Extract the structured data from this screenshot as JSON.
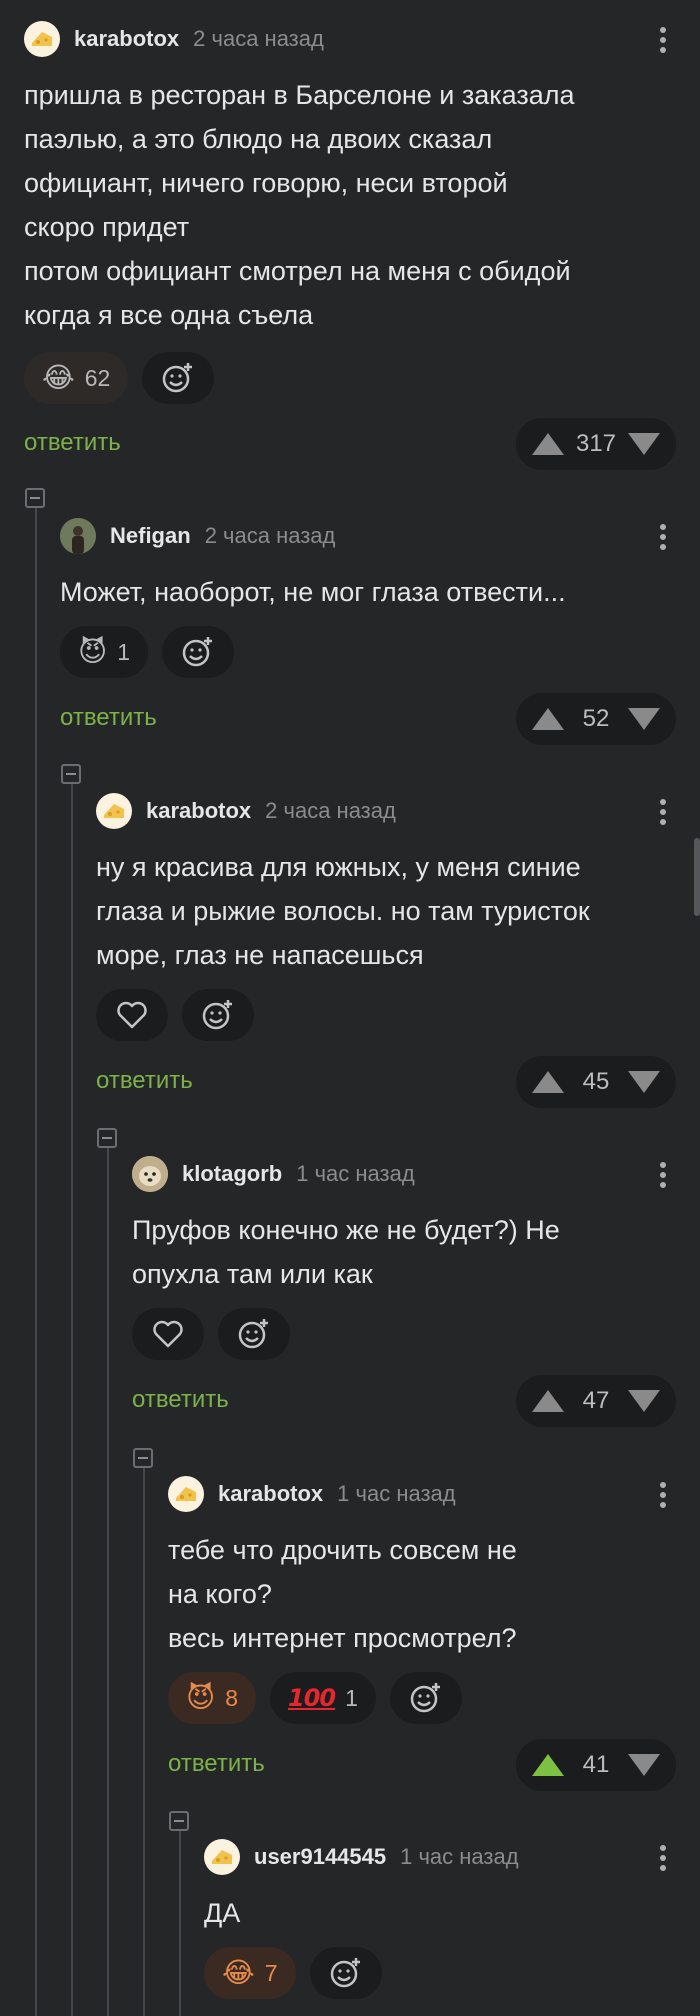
{
  "comments": [
    {
      "user": "karabotox",
      "time": "2 часа назад",
      "avatar": "cheese-avatar",
      "text": "пришла в ресторан в Барселоне и заказала\nпаэлью, а это блюдо на двоих сказал\nофициант, ничего говорю, неси второй\nскоро придет\nпотом официант смотрел на меня с обидой\nкогда я все одна съела",
      "reactions": [
        {
          "emoji": "😂",
          "count": "62"
        }
      ],
      "reply": "ответить",
      "votes": "317"
    },
    {
      "user": "Nefigan",
      "time": "2 часа назад",
      "avatar": "person-avatar",
      "text": "Может, наоборот, не мог глаза отвести...",
      "reactions": [
        {
          "emoji": "😈",
          "count": "1"
        }
      ],
      "reply": "ответить",
      "votes": "52"
    },
    {
      "user": "karabotox",
      "time": "2 часа назад",
      "avatar": "cheese-avatar",
      "text": "ну я красива для южных, у меня синие\nглаза и рыжие волосы. но там туристок\nморе, глаз не напасешься",
      "reactions": [],
      "reply": "ответить",
      "votes": "45"
    },
    {
      "user": "klotagorb",
      "time": "1 час назад",
      "avatar": "dog-avatar",
      "text": "Пруфов конечно же не будет?) Не\nопухла там или как",
      "reactions": [],
      "reply": "ответить",
      "votes": "47"
    },
    {
      "user": "karabotox",
      "time": "1 час назад",
      "avatar": "cheese-avatar",
      "text": "тебе что дрочить совсем не\nна кого?\nвесь интернет просмотрел?",
      "reactions": [
        {
          "emoji": "😈",
          "count": "8"
        },
        {
          "emoji": "100",
          "count": "1"
        }
      ],
      "reply": "ответить",
      "votes": "41"
    },
    {
      "user": "user9144545",
      "time": "1 час назад",
      "avatar": "cheese-avatar",
      "text": "ДА",
      "reactions": [
        {
          "emoji": "😂",
          "count": "7"
        }
      ]
    }
  ],
  "colors": {
    "background": "#252628",
    "reply_green": "#7db14a",
    "upvote_active": "#7cc142",
    "reaction_active": "#e8894d"
  }
}
